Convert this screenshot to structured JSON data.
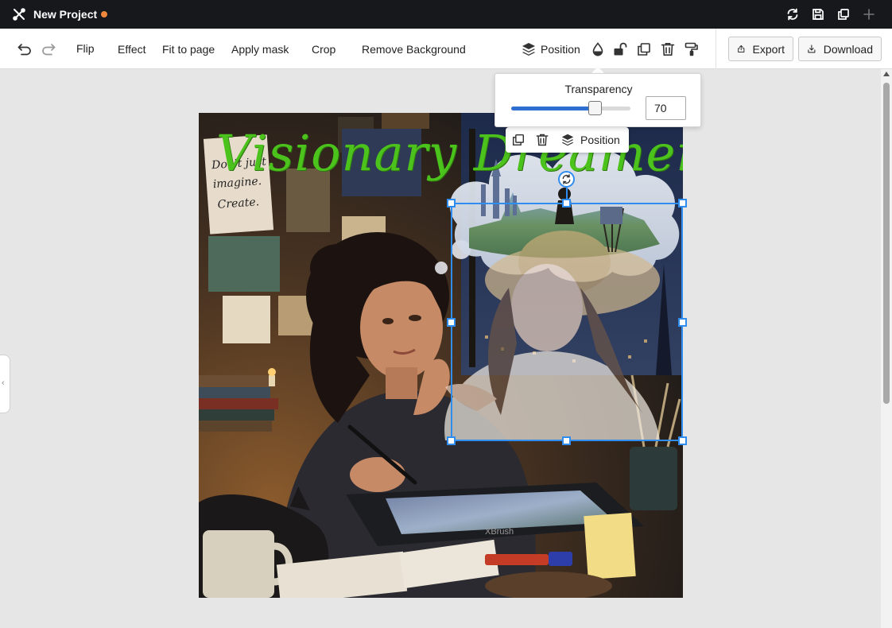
{
  "window": {
    "title": "New Project",
    "unsaved_color": "#f0883e"
  },
  "titlebar_icons": [
    "refresh-icon",
    "save-icon",
    "duplicate-window-icon",
    "plus-icon"
  ],
  "toolbar": {
    "flip": "Flip",
    "effect": "Effect",
    "fit_to_page": "Fit to page",
    "apply_mask": "Apply mask",
    "crop": "Crop",
    "remove_background": "Remove Background",
    "position": "Position",
    "export": "Export",
    "download": "Download"
  },
  "transparency": {
    "label": "Transparency",
    "value": "70",
    "percent": 70
  },
  "context_toolbar": {
    "position": "Position"
  },
  "canvas": {
    "title_text": "Visionary Dreamer!",
    "title_color": "#4cc21c",
    "selection_color": "#2f8df0"
  }
}
